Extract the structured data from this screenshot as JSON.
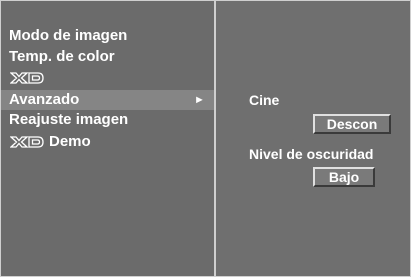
{
  "menu": {
    "items": [
      {
        "label": "Modo de imagen"
      },
      {
        "label": "Temp. de color"
      },
      {
        "logo": "XD"
      },
      {
        "label": "Avanzado",
        "selected": true,
        "arrow": "►"
      },
      {
        "label": "Reajuste imagen"
      },
      {
        "logo": "XD",
        "label": "Demo"
      }
    ]
  },
  "submenu": {
    "cinema": {
      "label": "Cine",
      "value": "Descon"
    },
    "black_level": {
      "label": "Nivel de oscuridad",
      "value": "Bajo"
    }
  },
  "colors": {
    "panel": "#6b6b6b",
    "selected": "#858585",
    "border": "#cfcfcf",
    "text": "#ffffff"
  }
}
